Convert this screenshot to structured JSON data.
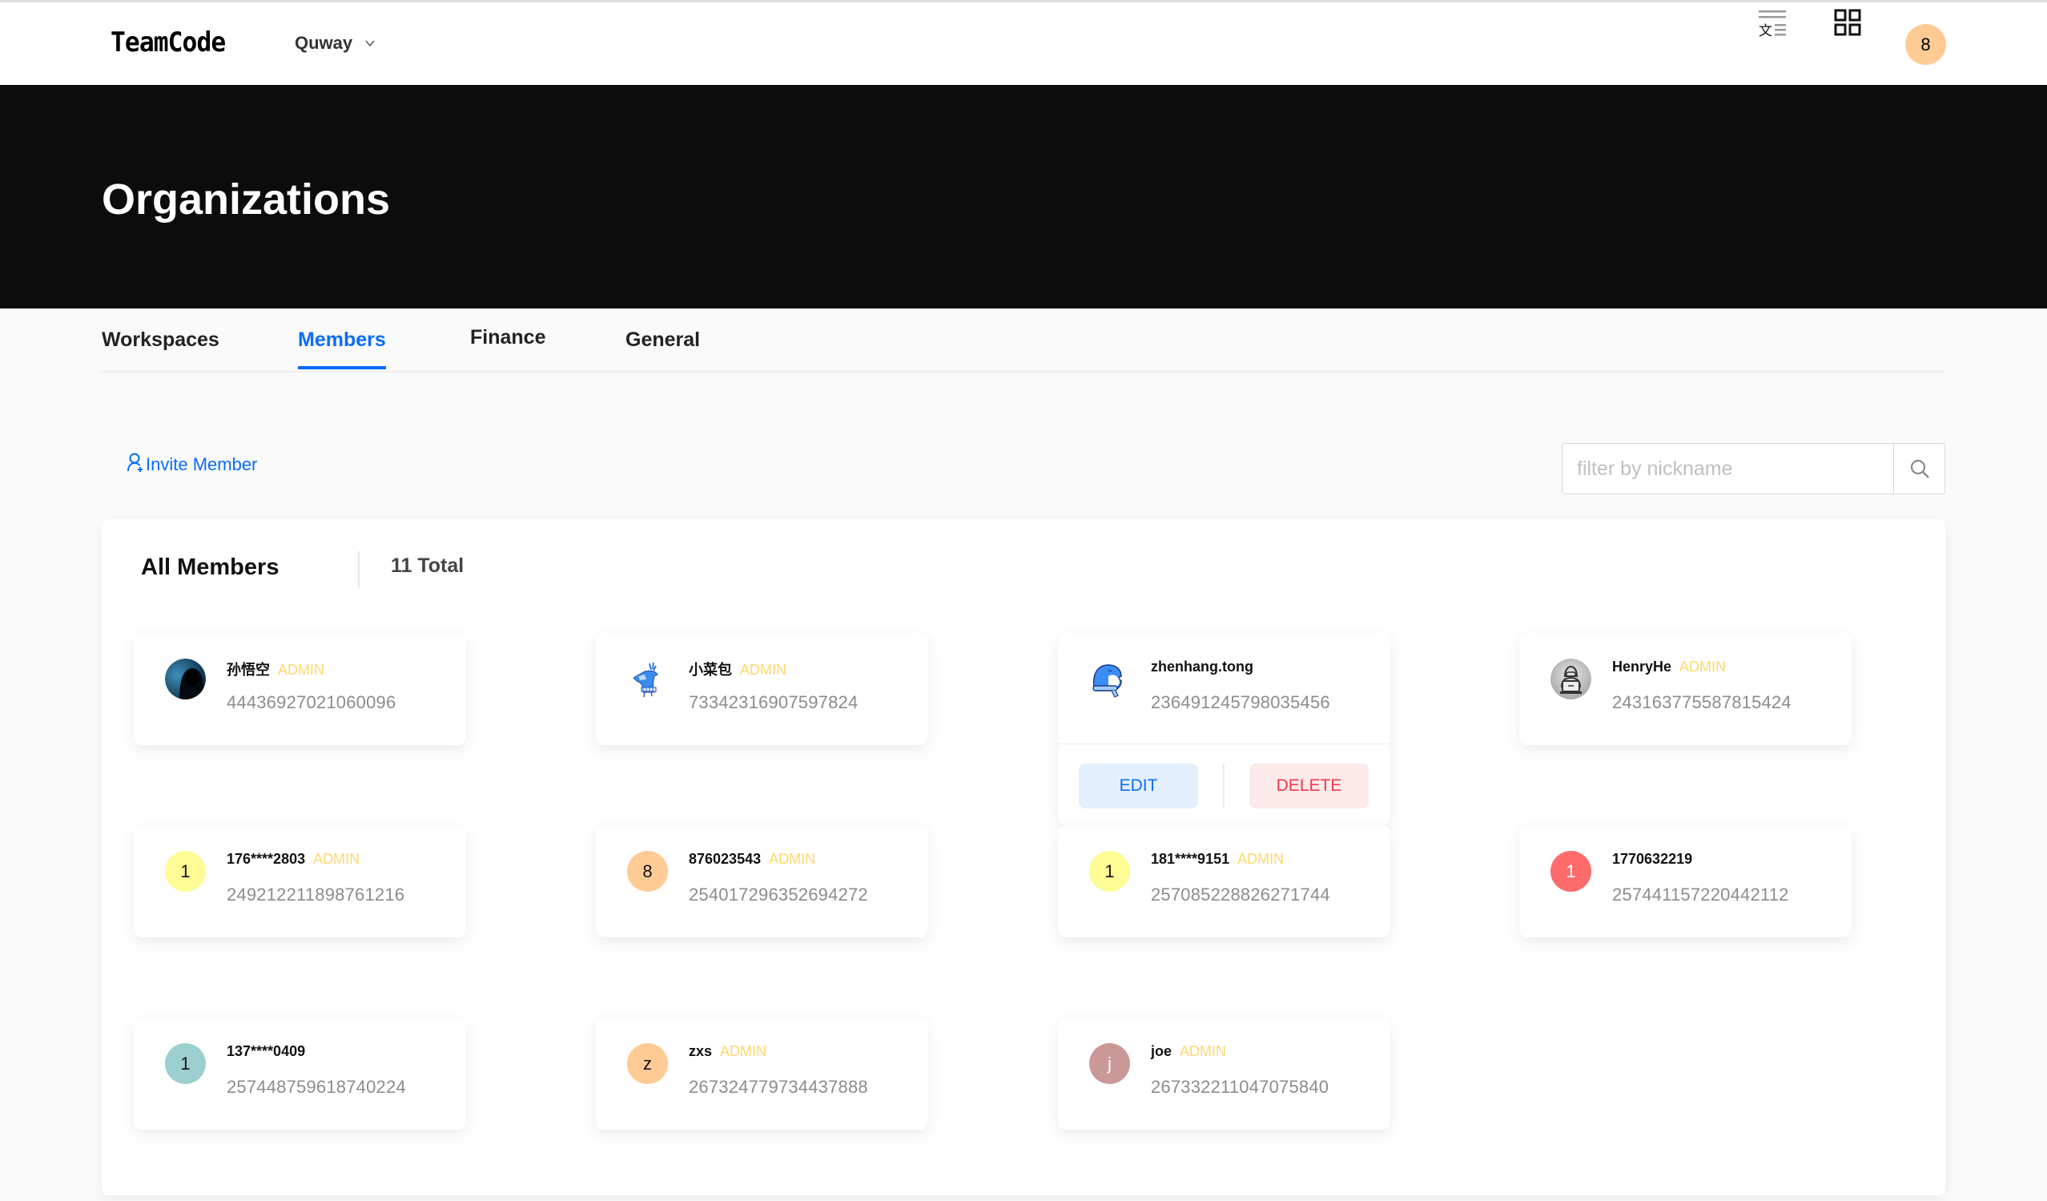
{
  "topnav": {
    "logo": "TeamCode",
    "org_name": "Quway",
    "icons": {
      "language": "translate-icon",
      "apps": "grid-apps-icon"
    },
    "user_avatar_initial": "8",
    "user_avatar_color": "#fecb95"
  },
  "hero": {
    "title": "Organizations"
  },
  "tabs": [
    {
      "label": "Workspaces",
      "active": false
    },
    {
      "label": "Members",
      "active": true
    },
    {
      "label": "Finance",
      "active": false
    },
    {
      "label": "General",
      "active": false
    }
  ],
  "toolbar": {
    "invite_label": "Invite Member",
    "search_placeholder": "filter by nickname",
    "search_value": ""
  },
  "members_panel": {
    "title": "All Members",
    "total_label": "11 Total"
  },
  "colors": {
    "accent": "#0a6cff",
    "admin_badge": "#ffd86b",
    "danger": "#f2384a",
    "hero_bg": "#0c0c0c"
  },
  "members": [
    {
      "name": "孙悟空",
      "role": "ADMIN",
      "uid": "44436927021060096",
      "avatar": {
        "type": "image",
        "icon": "hooded-figure-avatar"
      }
    },
    {
      "name": "小菜包",
      "role": "ADMIN",
      "uid": "73342316907597824",
      "avatar": {
        "type": "image",
        "icon": "deer-avatar"
      }
    },
    {
      "name": "zhenhang.tong",
      "role": "",
      "uid": "236491245798035456",
      "avatar": {
        "type": "image",
        "icon": "penguin-avatar"
      },
      "expanded": true,
      "actions": {
        "edit": "EDIT",
        "delete": "DELETE"
      }
    },
    {
      "name": "HenryHe",
      "role": "ADMIN",
      "uid": "243163775587815424",
      "avatar": {
        "type": "image",
        "icon": "hacker-laptop-avatar"
      }
    },
    {
      "name": "176****2803",
      "role": "ADMIN",
      "uid": "249212211898761216",
      "avatar": {
        "type": "initial",
        "initial": "1",
        "color": "#fffb95",
        "text_color": "#111111"
      }
    },
    {
      "name": "876023543",
      "role": "ADMIN",
      "uid": "254017296352694272",
      "avatar": {
        "type": "initial",
        "initial": "8",
        "color": "#fecb95",
        "text_color": "#111111"
      }
    },
    {
      "name": "181****9151",
      "role": "ADMIN",
      "uid": "257085228826271744",
      "avatar": {
        "type": "initial",
        "initial": "1",
        "color": "#fffb95",
        "text_color": "#111111"
      }
    },
    {
      "name": "1770632219",
      "role": "",
      "uid": "257441157220442112",
      "avatar": {
        "type": "initial",
        "initial": "1",
        "color": "#ff6a6a",
        "text_color": "#ffffff"
      }
    },
    {
      "name": "137****0409",
      "role": "",
      "uid": "257448759618740224",
      "avatar": {
        "type": "initial",
        "initial": "1",
        "color": "#9ccfcf",
        "text_color": "#111111"
      }
    },
    {
      "name": "zxs",
      "role": "ADMIN",
      "uid": "267324779734437888",
      "avatar": {
        "type": "initial",
        "initial": "z",
        "color": "#fecb95",
        "text_color": "#111111"
      }
    },
    {
      "name": "joe",
      "role": "ADMIN",
      "uid": "267332211047075840",
      "avatar": {
        "type": "initial",
        "initial": "j",
        "color": "#cb9898",
        "text_color": "#ffffff"
      }
    }
  ]
}
